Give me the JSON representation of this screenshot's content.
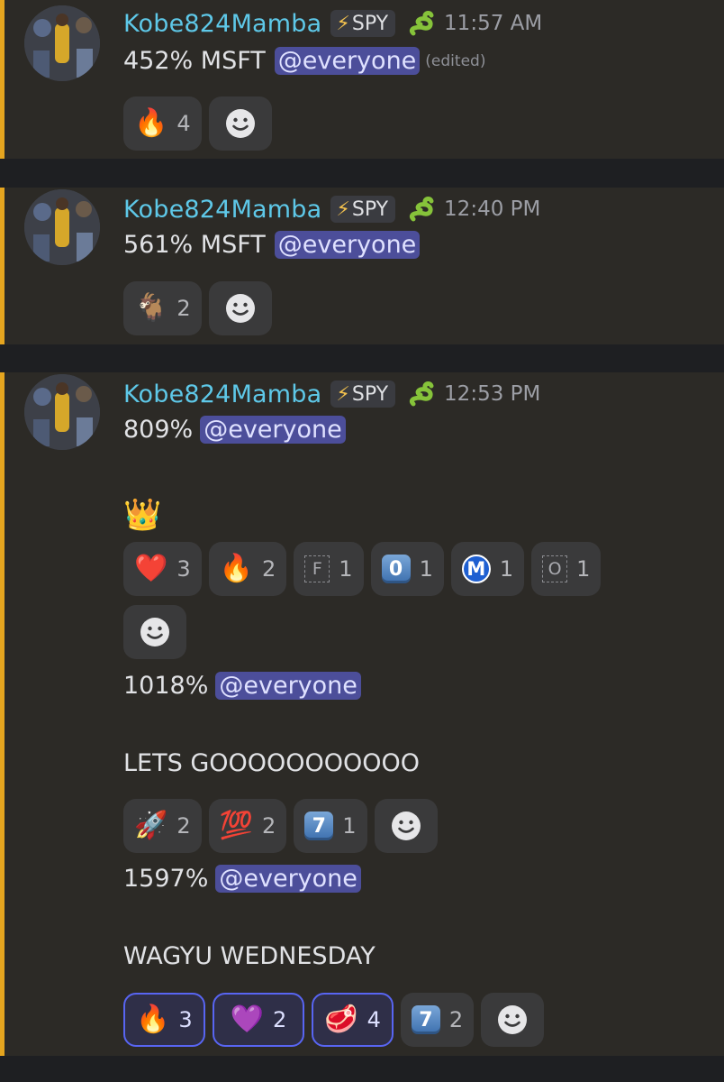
{
  "messages": [
    {
      "username": "Kobe824Mamba",
      "tag": "SPY",
      "time": "11:57 AM",
      "percent": "452% MSFT",
      "mention": "@everyone",
      "edited": "(edited)",
      "reactions": [
        {
          "emoji": "🔥",
          "count": "4"
        }
      ]
    },
    {
      "username": "Kobe824Mamba",
      "tag": "SPY",
      "time": "12:40 PM",
      "percent": "561% MSFT",
      "mention": "@everyone",
      "reactions": [
        {
          "emoji": "🐐",
          "count": "2"
        }
      ]
    },
    {
      "username": "Kobe824Mamba",
      "tag": "SPY",
      "time": "12:53 PM",
      "blocks": [
        {
          "line": "809%",
          "mention": "@everyone",
          "extra": "👑",
          "reactions": [
            {
              "emoji": "❤️",
              "count": "3"
            },
            {
              "emoji": "🔥",
              "count": "2"
            },
            {
              "emoji": "F",
              "count": "1"
            },
            {
              "emoji": "0",
              "count": "1"
            },
            {
              "emoji": "M",
              "count": "1"
            },
            {
              "emoji": "O",
              "count": "1"
            }
          ]
        },
        {
          "line": "1018%",
          "mention": "@everyone",
          "extra": "LETS GOOOOOOOOOOO",
          "reactions": [
            {
              "emoji": "🚀",
              "count": "2"
            },
            {
              "emoji": "💯",
              "count": "2"
            },
            {
              "emoji": "7",
              "count": "1"
            }
          ]
        },
        {
          "line": "1597%",
          "mention": "@everyone",
          "extra": "WAGYU WEDNESDAY",
          "reactions": [
            {
              "emoji": "🔥",
              "count": "3"
            },
            {
              "emoji": "💜",
              "count": "2"
            },
            {
              "emoji": "🥩",
              "count": "4"
            },
            {
              "emoji": "7",
              "count": "2"
            }
          ]
        }
      ]
    }
  ]
}
